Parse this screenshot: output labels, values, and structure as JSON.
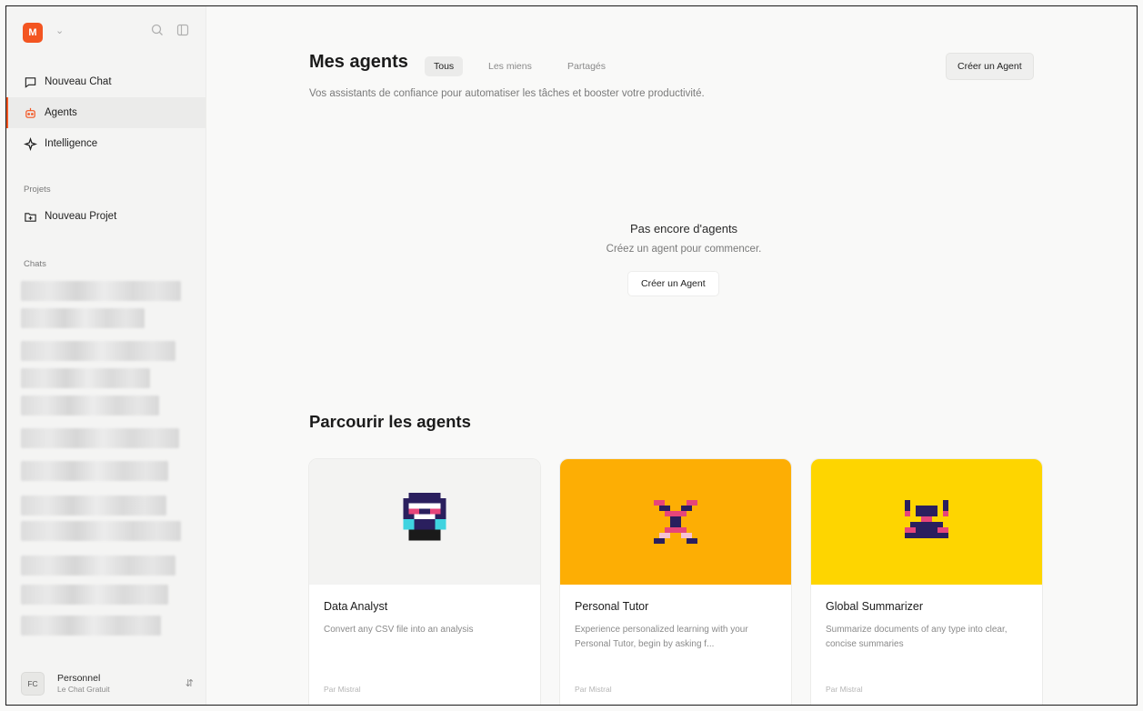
{
  "sidebar": {
    "logo_text": "M",
    "nav": [
      {
        "label": "Nouveau Chat",
        "icon": "chat-bubble-icon"
      },
      {
        "label": "Agents",
        "icon": "robot-icon"
      },
      {
        "label": "Intelligence",
        "icon": "sparkle-icon"
      }
    ],
    "projects_label": "Projets",
    "new_project_label": "Nouveau Projet",
    "chats_label": "Chats",
    "profile": {
      "initials": "FC",
      "name": "Personnel",
      "plan": "Le Chat Gratuit"
    }
  },
  "main": {
    "title": "Mes agents",
    "tabs": [
      {
        "label": "Tous",
        "active": true
      },
      {
        "label": "Les miens",
        "active": false
      },
      {
        "label": "Partagés",
        "active": false
      }
    ],
    "create_button": "Créer un Agent",
    "subtitle": "Vos assistants de confiance pour automatiser les tâches et booster votre productivité.",
    "empty": {
      "title": "Pas encore d'agents",
      "subtitle": "Créez un agent pour commencer.",
      "button": "Créer un Agent"
    },
    "browse_title": "Parcourir les agents",
    "cards": [
      {
        "title": "Data Analyst",
        "description": "Convert any CSV file into an analysis",
        "by": "Par Mistral",
        "color": "#f3f3f2"
      },
      {
        "title": "Personal Tutor",
        "description": "Experience personalized learning with your Personal Tutor, begin by asking f...",
        "by": "Par Mistral",
        "color": "#fdae04"
      },
      {
        "title": "Global Summarizer",
        "description": "Summarize documents of any type into clear, concise summaries",
        "by": "Par Mistral",
        "color": "#fed500"
      }
    ]
  },
  "colors": {
    "accent": "#f35521",
    "navy": "#2a1f5e",
    "pink": "#e6457a",
    "cyan": "#3fd3e0"
  }
}
